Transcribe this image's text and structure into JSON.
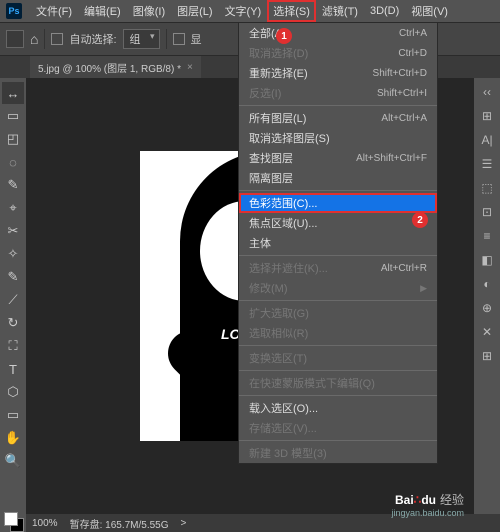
{
  "menubar": {
    "items": [
      "文件(F)",
      "编辑(E)",
      "图像(I)",
      "图层(L)",
      "文字(Y)",
      "选择(S)",
      "滤镜(T)",
      "3D(D)",
      "视图(V)"
    ],
    "activeIndex": 5
  },
  "optionbar": {
    "autoSelectLabel": "自动选择:",
    "autoSelectValue": "组",
    "showLabel": "显",
    "homeIcon": "⌂"
  },
  "docTab": {
    "title": "5.jpg @ 100% (图层 1, RGB/8) *",
    "close": "×"
  },
  "tools": [
    "↔",
    "▭",
    "◰",
    "◌",
    "✎",
    "⌖",
    "✂",
    "✧",
    "✎",
    "⟋",
    "↻",
    "⛶",
    "T",
    "⬡",
    "▭",
    "✋",
    "🔍"
  ],
  "rightIcons": [
    "‹‹",
    "⊞",
    "A|",
    "☰",
    "⬚",
    "⊡",
    "≡",
    "◧",
    "◐",
    "⊕",
    "✕",
    "⊞"
  ],
  "canvas": {
    "heartText": "LOVE"
  },
  "status": {
    "zoom": "100%",
    "info": "暂存盘: 165.7M/5.55G",
    "arrow": ">"
  },
  "menu": {
    "groups": [
      [
        {
          "label": "全部(A)",
          "shortcut": "Ctrl+A",
          "disabled": false
        },
        {
          "label": "取消选择(D)",
          "shortcut": "Ctrl+D",
          "disabled": true
        },
        {
          "label": "重新选择(E)",
          "shortcut": "Shift+Ctrl+D",
          "disabled": false
        },
        {
          "label": "反选(I)",
          "shortcut": "Shift+Ctrl+I",
          "disabled": true
        }
      ],
      [
        {
          "label": "所有图层(L)",
          "shortcut": "Alt+Ctrl+A",
          "disabled": false
        },
        {
          "label": "取消选择图层(S)",
          "shortcut": "",
          "disabled": false
        },
        {
          "label": "查找图层",
          "shortcut": "Alt+Shift+Ctrl+F",
          "disabled": false
        },
        {
          "label": "隔离图层",
          "shortcut": "",
          "disabled": false
        }
      ],
      [
        {
          "label": "色彩范围(C)...",
          "shortcut": "",
          "disabled": false,
          "highlighted": true
        },
        {
          "label": "焦点区域(U)...",
          "shortcut": "",
          "disabled": false
        },
        {
          "label": "主体",
          "shortcut": "",
          "disabled": false
        }
      ],
      [
        {
          "label": "选择并遮住(K)...",
          "shortcut": "Alt+Ctrl+R",
          "disabled": true
        },
        {
          "label": "修改(M)",
          "shortcut": "",
          "disabled": true,
          "submenu": true
        }
      ],
      [
        {
          "label": "扩大选取(G)",
          "shortcut": "",
          "disabled": true
        },
        {
          "label": "选取相似(R)",
          "shortcut": "",
          "disabled": true
        }
      ],
      [
        {
          "label": "变换选区(T)",
          "shortcut": "",
          "disabled": true
        }
      ],
      [
        {
          "label": "在快速蒙版模式下编辑(Q)",
          "shortcut": "",
          "disabled": true
        }
      ],
      [
        {
          "label": "载入选区(O)...",
          "shortcut": "",
          "disabled": false
        },
        {
          "label": "存储选区(V)...",
          "shortcut": "",
          "disabled": true
        }
      ],
      [
        {
          "label": "新建 3D 模型(3)",
          "shortcut": "",
          "disabled": true
        }
      ]
    ]
  },
  "badges": {
    "one": "1",
    "two": "2"
  },
  "watermark": {
    "brand1": "Bai",
    "brand2": "du",
    "suffix": "经验",
    "url": "jingyan.baidu.com"
  }
}
